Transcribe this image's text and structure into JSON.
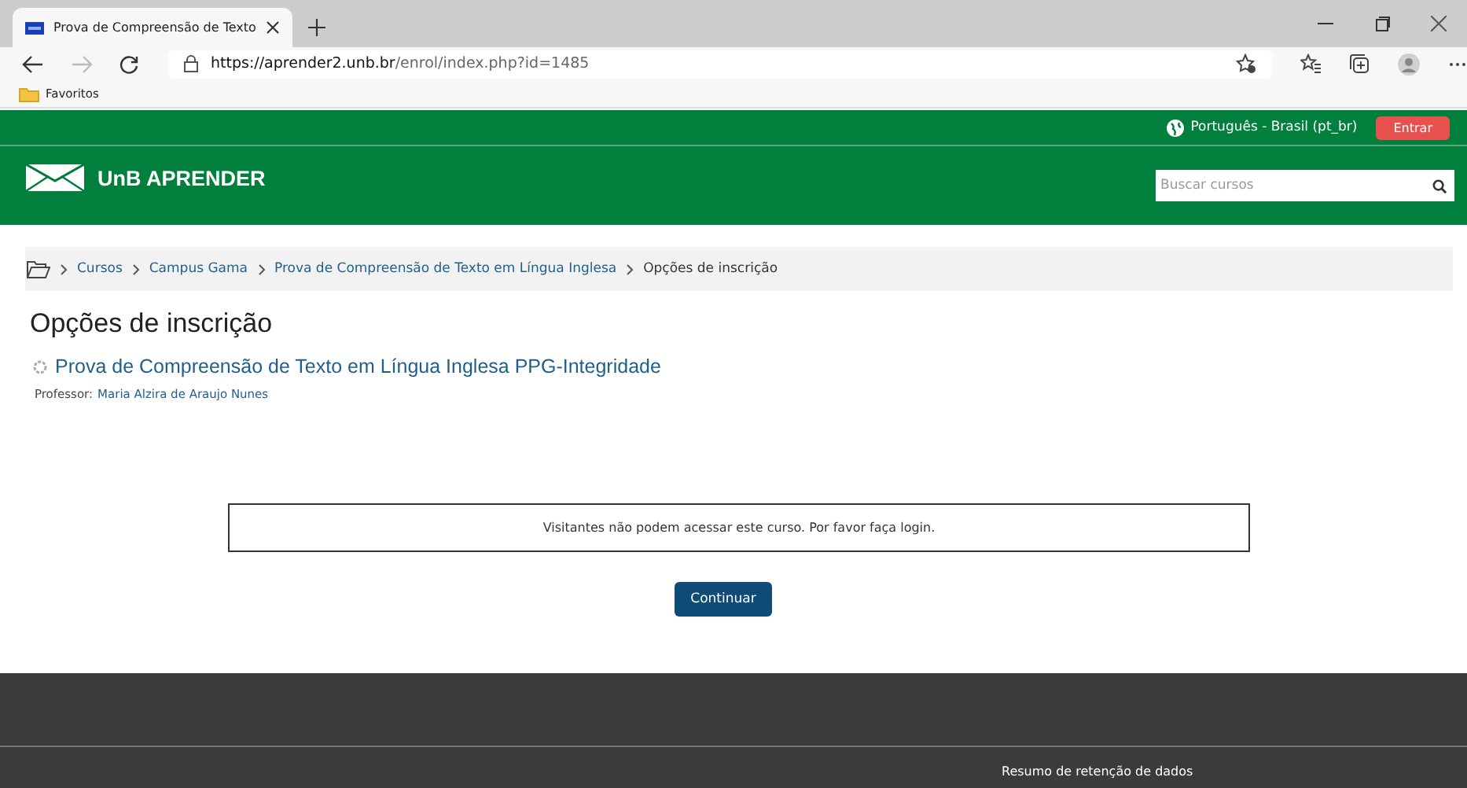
{
  "browser": {
    "tab": {
      "title": "Prova de Compreensão de Texto",
      "selected": true
    },
    "url": {
      "host": "https://aprender2.unb.br",
      "path": "/enrol/index.php?id=1485"
    },
    "bookmarks": [
      {
        "label": "Favoritos"
      }
    ]
  },
  "header": {
    "language": "Português - Brasil (pt_br)",
    "login_button": "Entrar",
    "brand": "UnB APRENDER",
    "search": {
      "placeholder": "Buscar cursos"
    }
  },
  "breadcrumb": [
    {
      "label": "Cursos",
      "link": true
    },
    {
      "label": "Campus Gama",
      "link": true
    },
    {
      "label": "Prova de Compreensão de Texto em Língua Inglesa",
      "link": true
    },
    {
      "label": "Opções de inscrição",
      "link": false
    }
  ],
  "page_title": "Opções de inscrição",
  "course": {
    "name": "Prova de Compreensão de Texto em Língua Inglesa PPG-Integridade",
    "teacher_label": "Professor:",
    "teacher": "Maria Alzira de Araujo Nunes"
  },
  "notice": "Visitantes não podem acessar este curso. Por favor faça login.",
  "continue_button": "Continuar",
  "footer": {
    "links": [
      "Resumo de retenção de dados"
    ]
  }
}
